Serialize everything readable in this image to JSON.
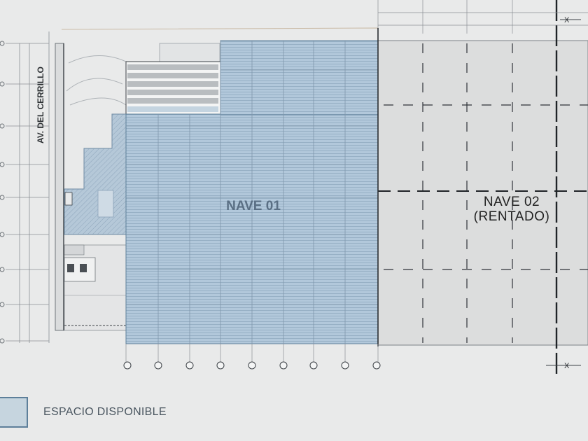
{
  "plan": {
    "street_name": "AV. DEL CERRILLO",
    "bay_1_label": "NAVE 01",
    "bay_2_label_line1": "NAVE 02",
    "bay_2_label_line2": "(RENTADO)",
    "axis_marker": "X"
  },
  "legend": {
    "label": "ESPACIO DISPONIBLE",
    "swatch_color": "#c6d5df"
  },
  "colors": {
    "background": "#e9eaea",
    "available_fill": "#a9c1d6",
    "available_stroke": "#5d7f9a",
    "rented_fill": "#dcdddd",
    "label_text": "#4f6478",
    "nave02_text": "#333333"
  }
}
